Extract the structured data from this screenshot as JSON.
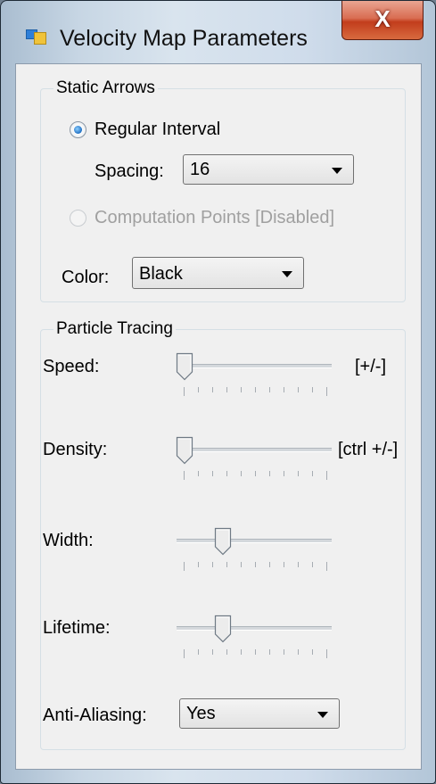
{
  "window": {
    "title": "Velocity Map Parameters",
    "close_label": "X"
  },
  "static_arrows": {
    "group_label": "Static Arrows",
    "regular_interval_label": "Regular Interval",
    "spacing_label": "Spacing:",
    "spacing_value": "16",
    "computation_points_label": "Computation Points [Disabled]",
    "color_label": "Color:",
    "color_value": "Black"
  },
  "particle_tracing": {
    "group_label": "Particle Tracing",
    "speed": {
      "label": "Speed:",
      "hint": "[+/-]",
      "level": 0.05
    },
    "density": {
      "label": "Density:",
      "hint": "[ctrl +/-]",
      "level": 0.05
    },
    "width": {
      "label": "Width:",
      "level": 0.3
    },
    "lifetime": {
      "label": "Lifetime:",
      "level": 0.3
    },
    "anti_aliasing_label": "Anti-Aliasing:",
    "anti_aliasing_value": "Yes"
  }
}
